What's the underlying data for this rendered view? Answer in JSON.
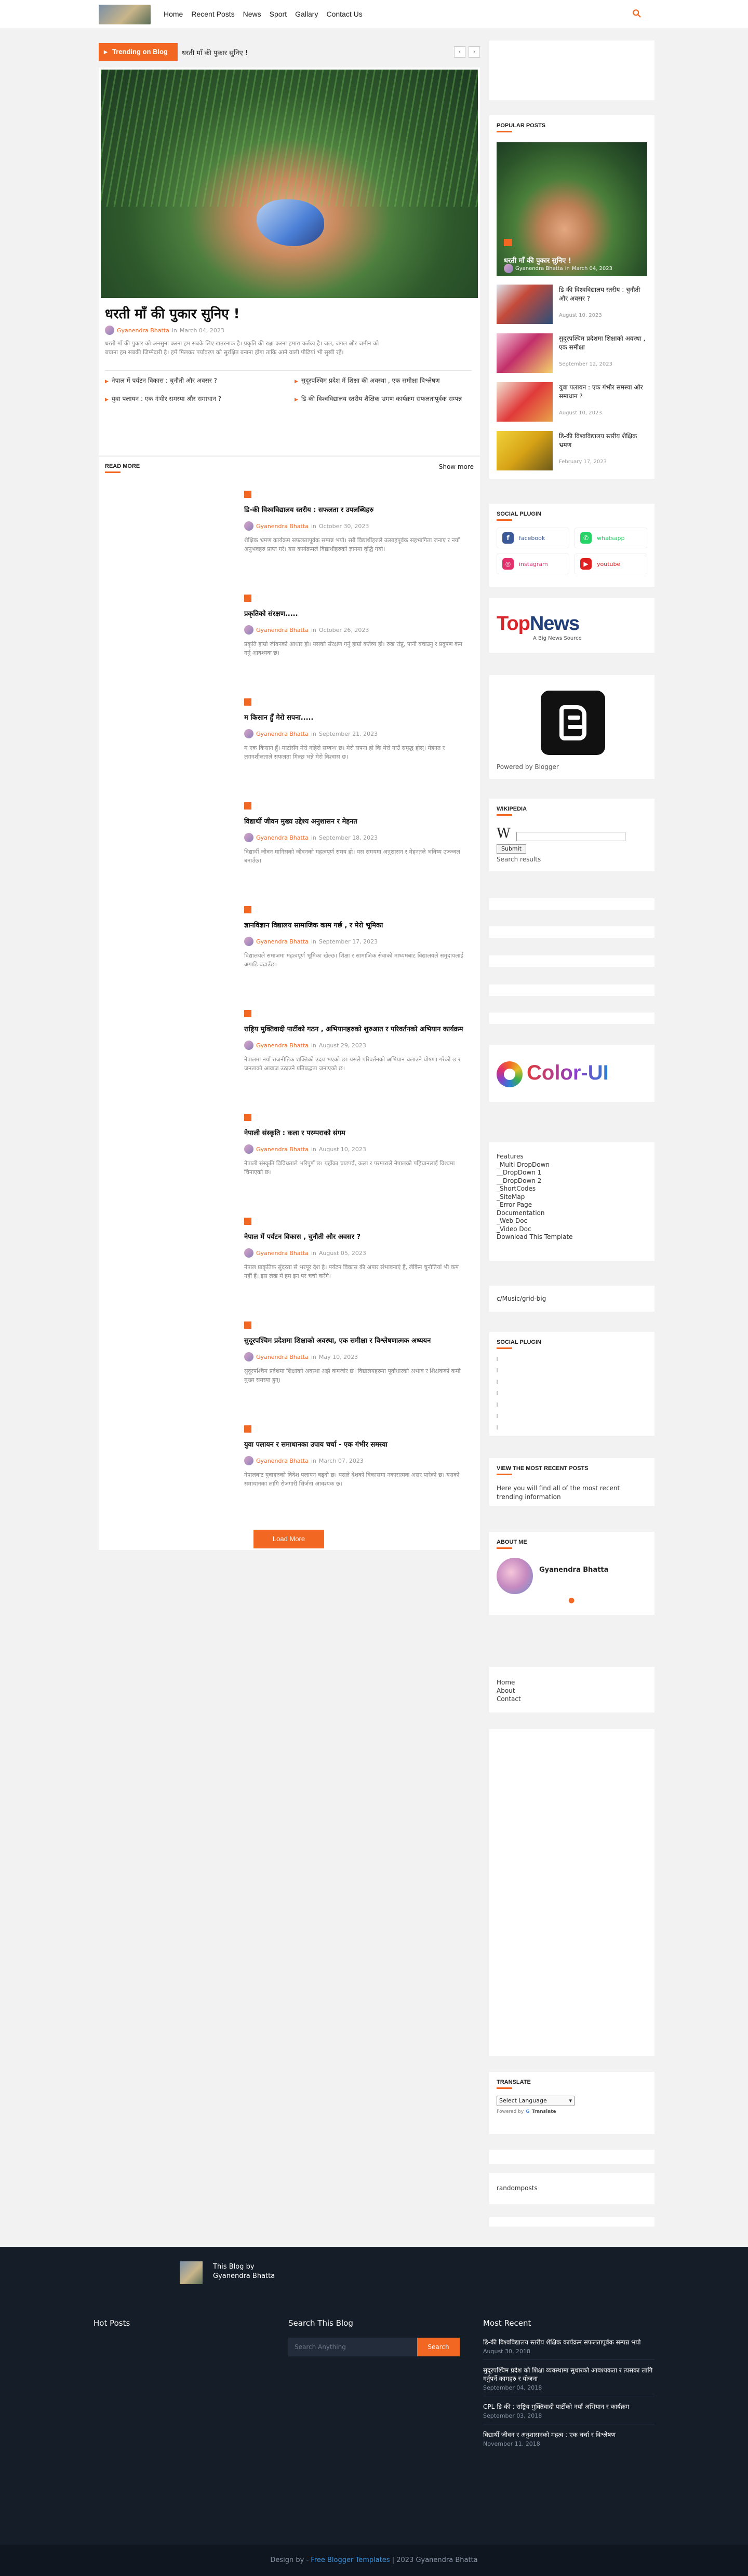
{
  "nav": {
    "items": [
      "Home",
      "Recent Posts",
      "News",
      "Sport",
      "Gallary",
      "Contact Us"
    ]
  },
  "trending": {
    "label": "Trending on Blog",
    "text": "धरती माँ की पुकार सुनिए !"
  },
  "featured": {
    "title": "धरती माँ की पुकार सुनिए !",
    "author": "Gyanendra Bhatta",
    "in": "in",
    "date": "March 04, 2023",
    "excerpt_1": "धरती माँ की पुकार को अनसुना करना हम सबके लिए खतरनाक है। प्रकृति की रक्षा करना हमारा कर्तव्य है। जल, जंगल और जमीन को",
    "excerpt_2": "बचाना हम सबकी जिम्मेदारी है। हमें मिलकर पर्यावरण को सुरक्षित बनाना होगा ताकि आने वाली पीढ़ियां भी सुखी रहें।",
    "related": [
      "नेपाल में पर्यटन विकास : चुनौती और अवसर ?",
      "सुदूरपश्चिम प्रदेश में शिक्षा की अवस्था , एक समीक्षा विश्लेषण",
      "युवा पलायन : एक गंभीर समस्या और समाधान ?",
      "डि-की विश्वविद्यालय स्तरीय शैक्षिक भ्रमण कार्यक्रम सफलतापूर्वक सम्पन्न"
    ]
  },
  "readmore": {
    "title": "READ MORE",
    "show_more": "Show more"
  },
  "posts": [
    {
      "title": "डि-की विश्वविद्यालय स्तरीय : सफलता र उपलब्धिहरु",
      "author": "Gyanendra Bhatta",
      "in": "in",
      "date": "October 30, 2023",
      "excerpt": "शैक्षिक भ्रमण कार्यक्रम सफलतापूर्वक सम्पन्न भयो। सबै विद्यार्थीहरुले उत्साहपूर्वक सहभागिता जनाए र नयाँ अनुभवहरु प्राप्त गरे। यस कार्यक्रमले विद्यार्थीहरुको ज्ञानमा वृद्धि गर्यो।"
    },
    {
      "title": "प्रकृतिको संरक्षण.....",
      "author": "Gyanendra Bhatta",
      "in": "in",
      "date": "October 26, 2023",
      "excerpt": "प्रकृति हाम्रो जीवनको आधार हो। यसको संरक्षण गर्नु हाम्रो कर्तव्य हो। रुख रोप्नु, पानी बचाउनु र प्रदुषण कम गर्नु आवश्यक छ।"
    },
    {
      "title": "म किसान हुँ मेरो सपना.....",
      "author": "Gyanendra Bhatta",
      "in": "in",
      "date": "September 21, 2023",
      "excerpt": "म एक किसान हुँ। माटोसँग मेरो गहिरो सम्बन्ध छ। मेरो सपना हो कि मेरो गाउँ समृद्ध होस्। मेहनत र लगनशीलताले सफलता मिल्छ भन्ने मेरो विश्वास छ।"
    },
    {
      "title": "विद्यार्थी जीवन मुख्य उद्देश्य अनुशासन र मेहनत",
      "author": "Gyanendra Bhatta",
      "in": "in",
      "date": "September 18, 2023",
      "excerpt": "विद्यार्थी जीवन मानिसको जीवनको महत्वपूर्ण समय हो। यस समयमा अनुशासन र मेहनतले भविष्य उज्ज्वल बनाउँछ।"
    },
    {
      "title": "ज्ञानविज्ञान विद्यालय सामाजिक काम गर्छ , र मेरो भूमिका",
      "author": "Gyanendra Bhatta",
      "in": "in",
      "date": "September 17, 2023",
      "excerpt": "विद्यालयले समाजमा महत्वपूर्ण भूमिका खेल्छ। शिक्षा र सामाजिक सेवाको माध्यमबाट विद्यालयले समुदायलाई अगाडि बढाउँछ।"
    },
    {
      "title": "राष्ट्रिय मुक्तिवादी पार्टीको गठन , अभियानहरुकाे शुरुआत र परिवर्तनको अभियान कार्यक्रम",
      "author": "Gyanendra Bhatta",
      "in": "in",
      "date": "August 29, 2023",
      "excerpt": "नेपालमा नयाँ राजनीतिक शक्तिको उदय भएको छ। यसले परिवर्तनको अभियान चलाउने घोषणा गरेको छ र जनताको आवाज उठाउने प्रतिबद्धता जनाएको छ।"
    },
    {
      "title": "नेपाली संस्कृति : कला र परम्पराको संगम",
      "author": "Gyanendra Bhatta",
      "in": "in",
      "date": "August 10, 2023",
      "excerpt": "नेपाली संस्कृति विविधताले भरिपूर्ण छ। यहाँका चाडपर्व, कला र परम्पराले नेपालको पहिचानलाई विश्वमा चिनाएको छ।"
    },
    {
      "title": "नेपाल में पर्यटन विकास , चुनौती और अवसर ?",
      "author": "Gyanendra Bhatta",
      "in": "in",
      "date": "August 05, 2023",
      "excerpt": "नेपाल प्राकृतिक सुंदरता से भरपूर देश है। पर्यटन विकास की अपार संभावनाएं हैं, लेकिन चुनौतियां भी कम नहीं हैं। इस लेख में हम इन पर चर्चा करेंगे।"
    },
    {
      "title": "सुदूरपश्चिम प्रदेशमा शिक्षाको अवस्था, एक समीक्षा र विश्लेषणात्मक अध्ययन",
      "author": "Gyanendra Bhatta",
      "in": "in",
      "date": "May 10, 2023",
      "excerpt": "सुदूरपश्चिम प्रदेशमा शिक्षाको अवस्था अझै कमजोर छ। विद्यालयहरुमा पूर्वाधारको अभाव र शिक्षकको कमी मुख्य समस्या हुन्।"
    },
    {
      "title": "युवा पलायन र समाधानका उपाय चर्चा - एक गंभीर समस्या",
      "author": "Gyanendra Bhatta",
      "in": "in",
      "date": "March 07, 2023",
      "excerpt": "नेपालबाट युवाहरुको विदेश पलायन बढ्दो छ। यसले देशको विकासमा नकारात्मक असर पारेको छ। यसको समाधानका लागि रोजगारी सिर्जना आवश्यक छ।"
    }
  ],
  "load_more": "Load More",
  "sidebar": {
    "popular_title": "POPULAR POSTS",
    "popular_big": {
      "title": "धरती माँ की पुकार सुनिए !",
      "author": "Gyanendra Bhatta",
      "in": "in",
      "date": "March 04, 2023"
    },
    "popular_items": [
      {
        "title": "डि-की विश्वविद्यालय स्तरीय : चुनौती और अवसर ?",
        "date": "August 10, 2023"
      },
      {
        "title": "सुदूरपश्चिम प्रदेशमा शिक्षाको अवस्था , एक समीक्षा",
        "date": "September 12, 2023"
      },
      {
        "title": "युवा पलायन : एक गंभीर समस्या और समाधान ?",
        "date": "August 10, 2023"
      },
      {
        "title": "डि-की विश्वविद्यालय स्तरीय शैक्षिक भ्रमण",
        "date": "February 17, 2023"
      }
    ],
    "social_title": "SOCIAL PLUGIN",
    "social": [
      {
        "name": "facebook",
        "color": "#3b5998"
      },
      {
        "name": "whatsapp",
        "color": "#25d366"
      },
      {
        "name": "instagram",
        "color": "#e1306c"
      },
      {
        "name": "youtube",
        "color": "#e02020"
      }
    ],
    "topnews": {
      "brand_a": "Top",
      "brand_b": "News",
      "tag": "A Big News Source"
    },
    "blogger": {
      "caption": "Powered by Blogger"
    },
    "wiki": {
      "title": "WIKIPEDIA",
      "button": "Submit",
      "results": "Search results"
    },
    "color_ui": "Color-UI",
    "features": [
      "Features",
      "_Multi DropDown",
      "__DropDown 1",
      "__DropDown 2",
      "_ShortCodes",
      "_SiteMap",
      "_Error Page",
      "Documentation",
      "_Web Doc",
      "_Video Doc",
      "Download This Template"
    ],
    "tag_line": "c/Music/grid-big",
    "social2_title": "SOCIAL PLUGIN",
    "recent_title": "VIEW THE MOST RECENT POSTS",
    "recent_text": "Here you will find all of the most recent trending information",
    "about_title": "ABOUT ME",
    "about_name": "Gyanendra Bhatta",
    "links": [
      "Home",
      "About",
      "Contact"
    ],
    "translate_title": "TRANSLATE",
    "translate_select": "Select Language",
    "translate_powered": "Powered by",
    "translate_brand": "Translate",
    "randomposts": "randomposts"
  },
  "footer": {
    "blog_by": "This Blog by Gyanendra Bhatta",
    "hot_posts": "Hot Posts",
    "search_title": "Search This Blog",
    "search_placeholder": "Search Anything",
    "search_button": "Search",
    "most_recent": "Most Recent",
    "recent": [
      {
        "title": "डि-की विश्वविद्यालय स्तरीय शैक्षिक कार्यक्रम सफलतापूर्वक सम्पन्न भयो",
        "date": "August 30, 2018"
      },
      {
        "title": "सुदूरपश्चिम प्रदेश को शिक्षा व्यवस्थामा सुधारको आवश्यकता र त्यसका लागि गर्नुपर्ने कामहरु र योजना",
        "date": "September 04, 2018"
      },
      {
        "title": "CPL-डि-की : राष्ट्रिय मुक्तिवादी पार्टीको नयाँ अभियान र कार्यक्रम",
        "date": "September 03, 2018"
      },
      {
        "title": "विद्यार्थी जीवन र अनुशासनको महत्व : एक चर्चा र विश्लेषण",
        "date": "November 11, 2018"
      }
    ],
    "credit_a": "Design by -",
    "credit_b": "Free Blogger Templates",
    "credit_c": "| 2023 Gyanendra Bhatta"
  }
}
